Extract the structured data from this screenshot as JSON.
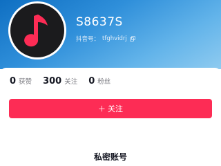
{
  "profile": {
    "username": "S8637S",
    "douyin_id_label": "抖音号：",
    "douyin_id": "tfghvidrj"
  },
  "stats": [
    {
      "value": "0",
      "label": "获赞"
    },
    {
      "value": "300",
      "label": "关注"
    },
    {
      "value": "0",
      "label": "粉丝"
    }
  ],
  "actions": {
    "follow_icon": "＋",
    "follow_label": "关注"
  },
  "notice": {
    "title": "私密账号"
  },
  "colors": {
    "follow_button": "#fd2c55",
    "header_gradient_start": "#0f6fc2",
    "header_gradient_end": "#8fcbf0",
    "avatar_note": "#fd2c55"
  },
  "icons": {
    "avatar": "music-note-icon",
    "copy": "copy-icon"
  }
}
